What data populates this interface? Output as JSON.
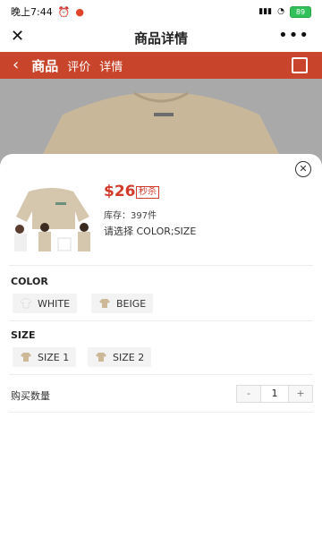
{
  "status_bar": {
    "time": "晚上7:44",
    "battery": "89"
  },
  "title_bar": {
    "title": "商品详情"
  },
  "nav": {
    "back_icon": "chevron-left-icon",
    "tabs": [
      "商品",
      "评价",
      "详情"
    ],
    "share_icon": "share-icon"
  },
  "sheet": {
    "price": "$26",
    "badge": "秒杀",
    "stock": "库存：397件",
    "select_hint": "请选择 COLOR;SIZE",
    "color": {
      "title": "COLOR",
      "options": [
        "WHITE",
        "BEIGE"
      ]
    },
    "size": {
      "title": "SIZE",
      "options": [
        "SIZE 1",
        "SIZE 2"
      ]
    },
    "quantity": {
      "label": "购买数量",
      "minus": "-",
      "value": "1",
      "plus": "+"
    }
  },
  "colors": {
    "accent": "#c8452c",
    "price": "#d23b2a"
  }
}
